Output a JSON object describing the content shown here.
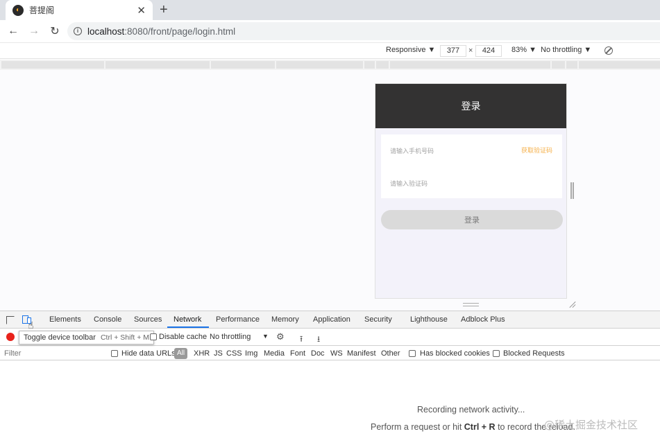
{
  "browser": {
    "tab_title": "菩提阁",
    "tab_close": "✕",
    "new_tab": "+",
    "url": "localhost:8080/front/page/login.html",
    "url_host": "localhost",
    "url_path": ":8080/front/page/login.html"
  },
  "device_toolbar": {
    "device": "Responsive ▼",
    "width": "377",
    "times": "×",
    "height": "424",
    "zoom": "83% ▼",
    "throttle": "No throttling ▼"
  },
  "page": {
    "header_title": "登录",
    "phone_placeholder": "请输入手机号码",
    "get_code": "获取验证码",
    "code_placeholder": "请输入验证码",
    "login_button": "登录"
  },
  "devtools": {
    "tabs": [
      "Elements",
      "Console",
      "Sources",
      "Network",
      "Performance",
      "Memory",
      "Application",
      "Security",
      "Lighthouse",
      "Adblock Plus"
    ],
    "active_tab": "Network",
    "tooltip_text": "Toggle device toolbar",
    "tooltip_shortcut": "Ctrl + Shift + M",
    "disable_cache": "Disable cache",
    "throttling": "No throttling",
    "filter_placeholder": "Filter",
    "hide_data_urls": "Hide data URLs",
    "types": [
      "All",
      "XHR",
      "JS",
      "CSS",
      "Img",
      "Media",
      "Font",
      "Doc",
      "WS",
      "Manifest",
      "Other"
    ],
    "has_blocked_cookies": "Has blocked cookies",
    "blocked_requests": "Blocked Requests",
    "recording_msg": "Recording network activity...",
    "hint_prefix": "Perform a request or hit ",
    "hint_keys": "Ctrl + R",
    "hint_suffix": " to record the reload."
  },
  "watermark": "@稀土掘金技术社区",
  "colors": {
    "accent": "#1a73e8",
    "record": "#e8221b",
    "header_dark": "#333232",
    "get_code": "#f5b04a"
  }
}
